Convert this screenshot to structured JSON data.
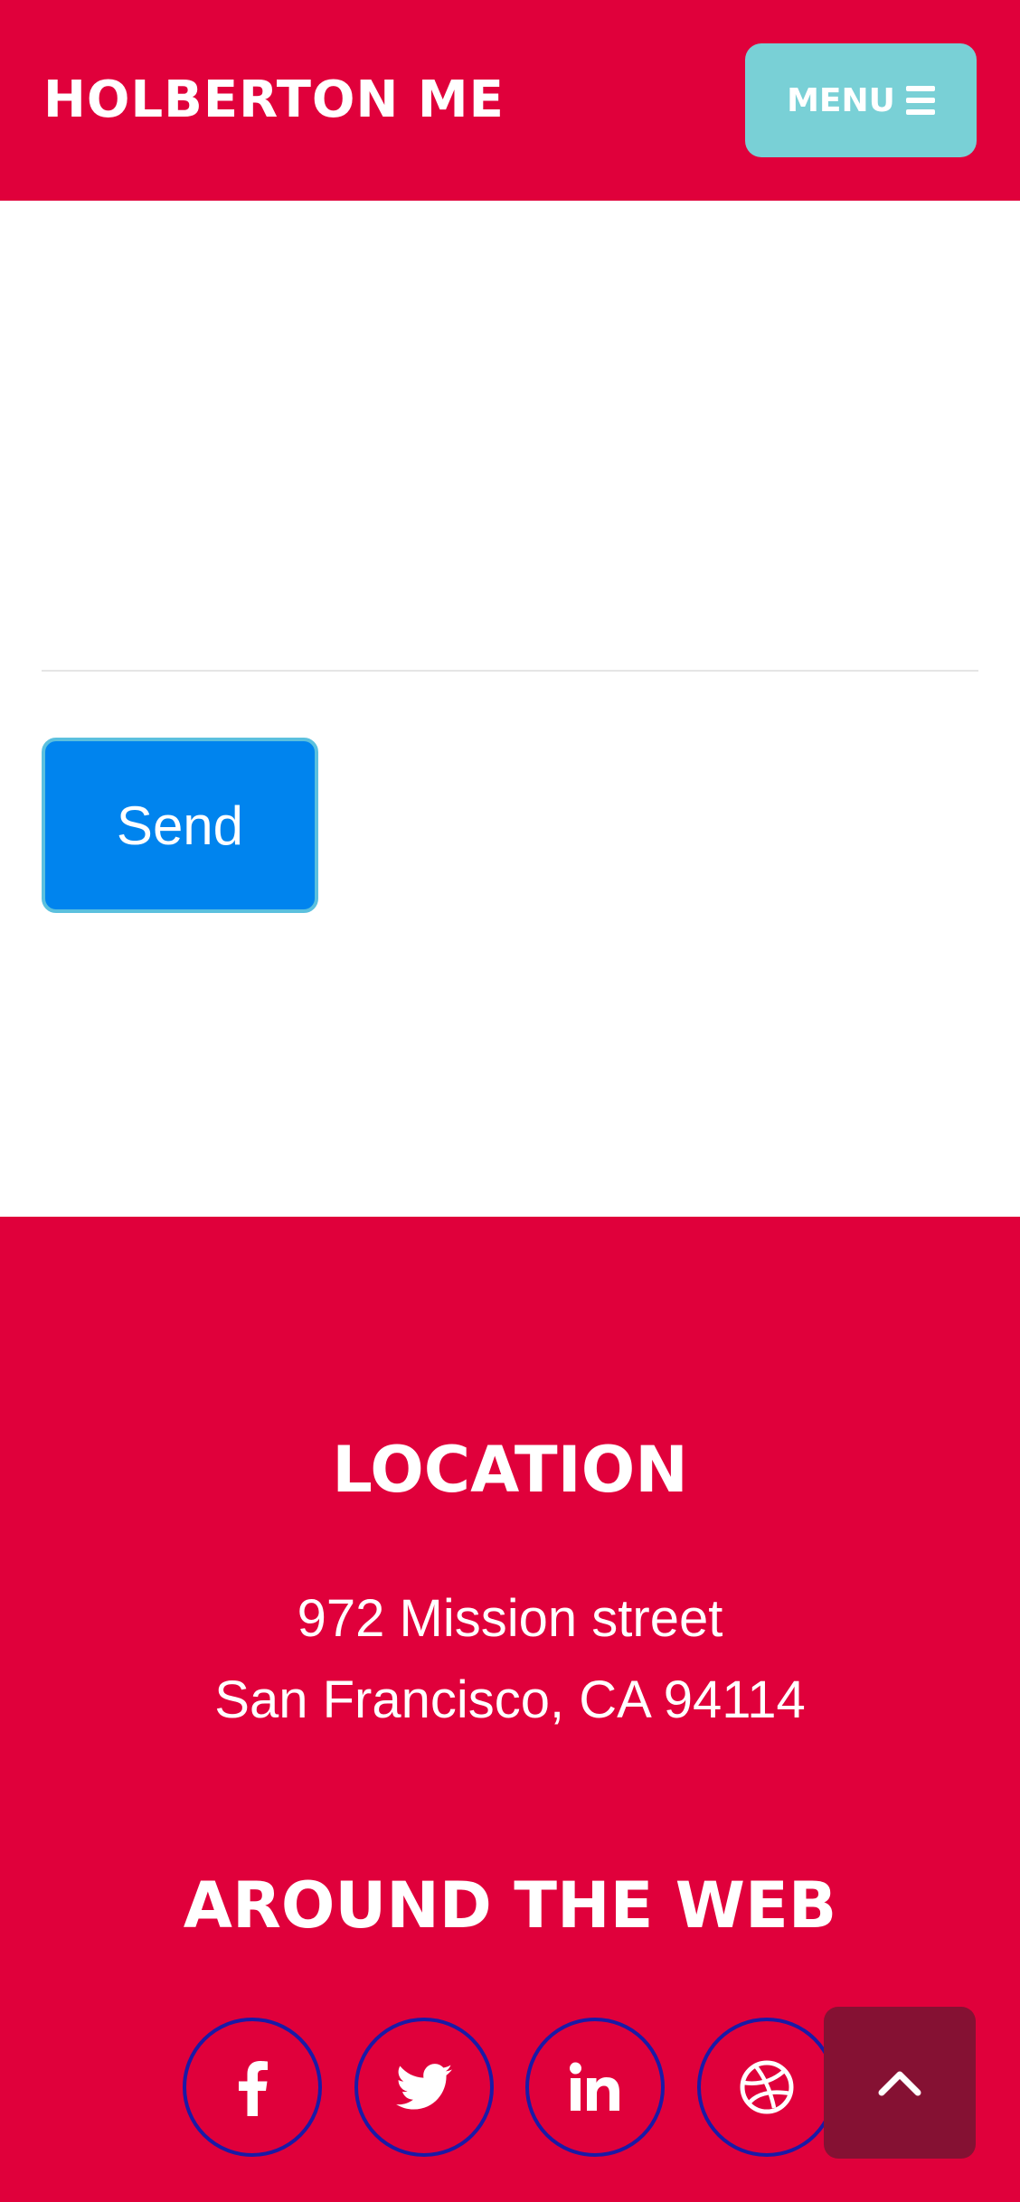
{
  "navbar": {
    "brand": "HOLBERTON ME",
    "menu_label": "MENU",
    "menu_icon": "hamburger-icon",
    "background": "#e0003b",
    "menu_background": "#79d0d6"
  },
  "form": {
    "send_label": "Send",
    "send_color": "#0084ee"
  },
  "footer": {
    "background": "#e0003b",
    "location_title": "LOCATION",
    "address_line1": "972 Mission street",
    "address_line2": "San Francisco, CA 94114",
    "around_title": "AROUND THE WEB",
    "social_icons": [
      "facebook-icon",
      "twitter-icon",
      "linkedin-icon",
      "dribbble-icon"
    ]
  },
  "scroll_top": {
    "icon": "chevron-up-icon",
    "background": "#851133"
  }
}
